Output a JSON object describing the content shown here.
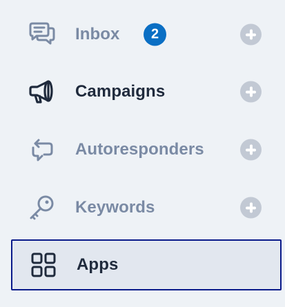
{
  "menu": {
    "items": [
      {
        "label": "Inbox",
        "icon": "chat-bubbles-icon",
        "badge": "2",
        "has_add": true,
        "state": "muted"
      },
      {
        "label": "Campaigns",
        "icon": "megaphone-icon",
        "has_add": true,
        "state": "dark"
      },
      {
        "label": "Autoresponders",
        "icon": "autoresponder-arrows-icon",
        "has_add": true,
        "state": "muted"
      },
      {
        "label": "Keywords",
        "icon": "key-icon",
        "has_add": true,
        "state": "muted"
      },
      {
        "label": "Apps",
        "icon": "apps-grid-icon",
        "has_add": false,
        "state": "active"
      }
    ]
  },
  "colors": {
    "background": "#eef2f6",
    "muted_text": "#7a8aa4",
    "dark_text": "#1f2a3c",
    "badge": "#0a6fc4",
    "add_button": "#c2c9d4",
    "active_border": "#0a1a8a",
    "active_background": "#e2e7ef"
  }
}
